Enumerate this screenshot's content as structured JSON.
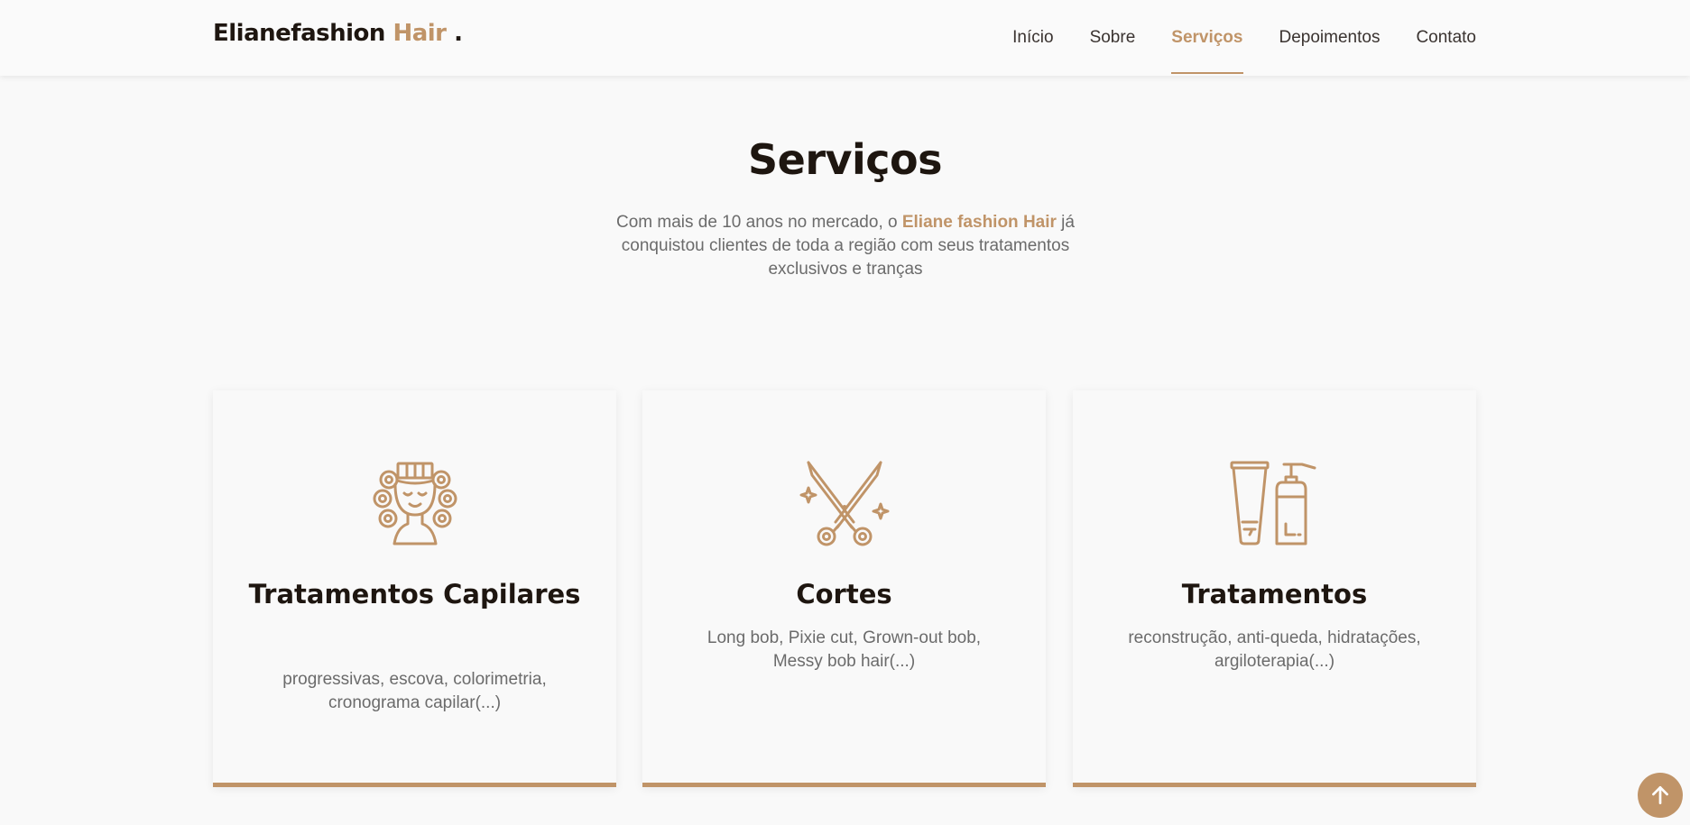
{
  "header": {
    "logo_main": "Elianefashion",
    "logo_accent": "Hair",
    "logo_dot": ".",
    "nav": [
      {
        "label": "Início"
      },
      {
        "label": "Sobre"
      },
      {
        "label": "Serviços"
      },
      {
        "label": "Depoimentos"
      },
      {
        "label": "Contato"
      }
    ]
  },
  "services": {
    "title": "Serviços",
    "intro_before": "Com mais de 10 anos no mercado, o ",
    "intro_brand": "Eliane fashion Hair",
    "intro_after": " já conquistou clientes de toda a região com seus tratamentos exclusivos e tranças",
    "cards": [
      {
        "icon": "hair-curlers-icon",
        "title": "Tratamentos Capilares",
        "description": "progressivas, escova, colorimetria, cronograma capilar(...)"
      },
      {
        "icon": "scissors-icon",
        "title": "Cortes",
        "description": "Long bob, Pixie cut, Grown-out bob, Messy bob hair(...)"
      },
      {
        "icon": "hair-products-icon",
        "title": "Tratamentos",
        "description": "reconstrução, anti-queda, hidratações, argiloterapia(...)"
      }
    ]
  },
  "colors": {
    "accent": "#c09468",
    "dark": "#1e1610",
    "text": "#6b6b6b",
    "background": "#f9f9f9"
  }
}
